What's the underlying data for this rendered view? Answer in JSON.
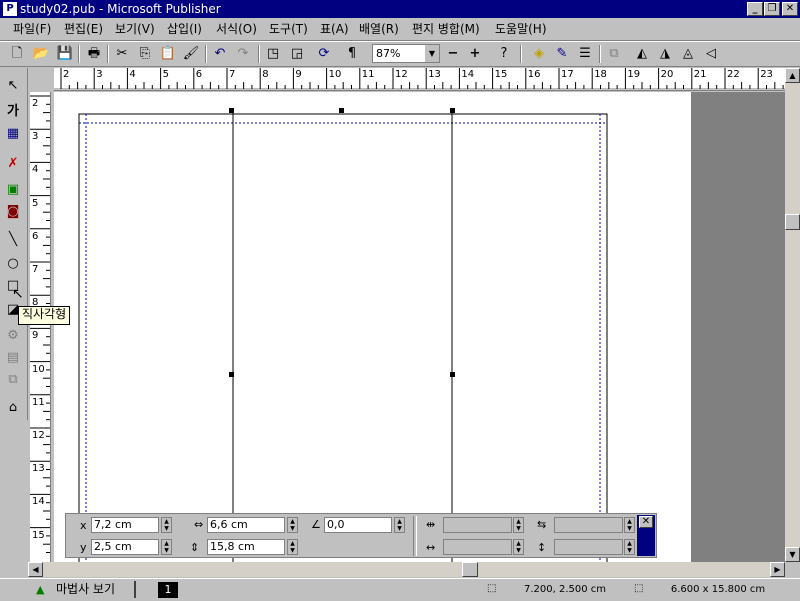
{
  "window": {
    "title": "study02.pub - Microsoft Publisher"
  },
  "menu": [
    "파일(F)",
    "편집(E)",
    "보기(V)",
    "삽입(I)",
    "서식(O)",
    "도구(T)",
    "표(A)",
    "배열(R)",
    "편지 병합(M)",
    "도움말(H)"
  ],
  "toolbar": {
    "zoom": "87%"
  },
  "ruler": {
    "h_labels": [
      "2",
      "3",
      "4",
      "5",
      "6",
      "7",
      "8",
      "9",
      "10",
      "11",
      "12",
      "13",
      "14",
      "15",
      "16",
      "17",
      "18",
      "19",
      "20",
      "21",
      "22",
      "23"
    ],
    "v_labels": [
      "2",
      "3",
      "4",
      "5",
      "6",
      "7",
      "8",
      "9",
      "10",
      "11",
      "12",
      "13",
      "14",
      "15"
    ]
  },
  "tooltip": "직사각형",
  "measurements": {
    "x_label": "x",
    "x_value": "7,2 cm",
    "y_label": "y",
    "y_value": "2,5 cm",
    "width_value": "6,6 cm",
    "height_value": "15,8 cm",
    "rotation_value": "0,0"
  },
  "status": {
    "wizard_label": "마법사 보기",
    "page_number": "1",
    "position": "7.200, 2.500 cm",
    "size": "6.600 x 15.800 cm"
  },
  "colors": {
    "titlebar": "#000080",
    "chrome": "#c0c0c0"
  }
}
